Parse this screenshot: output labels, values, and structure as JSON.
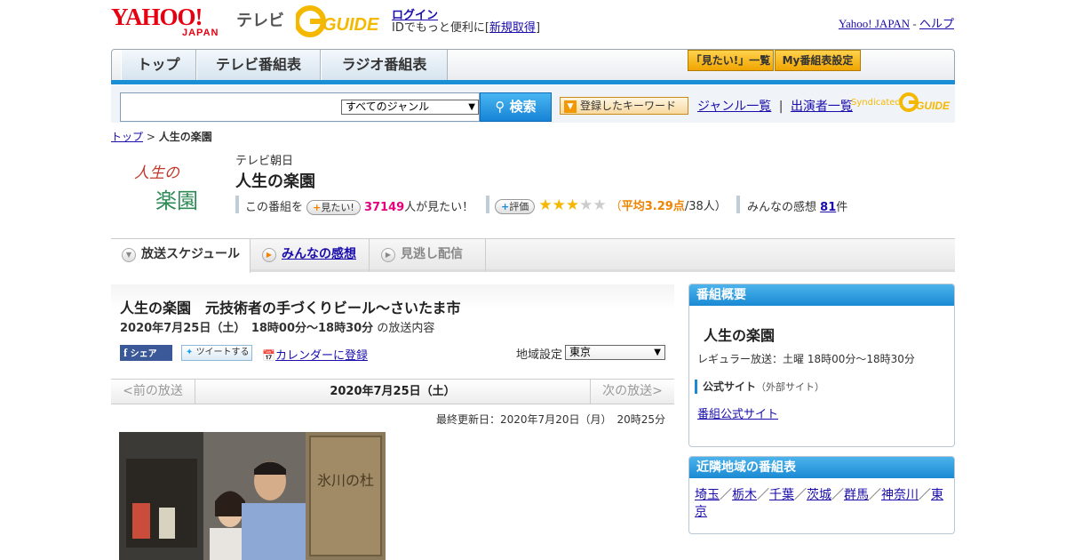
{
  "header": {
    "logo_yahoo": "YAHOO!",
    "logo_japan": "JAPAN",
    "tv": "テレビ",
    "gguide": "GUIDE",
    "login": "ログイン",
    "login_line_pre": "IDでもっと便利に[",
    "signup": "新規取得",
    "login_line_post": "]",
    "yahoo_japan": "Yahoo! JAPAN",
    "sep": " - ",
    "help": "ヘルプ"
  },
  "nav": {
    "tabs": [
      "トップ",
      "テレビ番組表",
      "ラジオ番組表"
    ],
    "mitai_list": "「見たい!」一覧",
    "my_schedule": "My番組表設定"
  },
  "search": {
    "placeholder": "",
    "genre": "すべてのジャンル",
    "button": "検索",
    "keywords": "登録したキーワード",
    "genre_list": "ジャンル一覧",
    "divider": "|",
    "performers": "出演者一覧",
    "syndicated": "Syndicated"
  },
  "breadcrumb": {
    "top": "トップ",
    "sep": " > ",
    "current": "人生の楽園"
  },
  "program": {
    "logo_text_1": "人生の",
    "logo_text_2": "楽園",
    "channel": "テレビ朝日",
    "title": "人生の楽園",
    "this_program": "この番組を",
    "mitai_pill": "見たい!",
    "mitai_count": "37149",
    "mitai_suffix": "人が見たい！",
    "rating_pill": "評価",
    "stars_filled": "★★★",
    "stars_empty": "★★",
    "rating_pre": "（",
    "rating_avg": "平均3.29点",
    "rating_post": "/38人）",
    "reviews_pre": "みんなの感想",
    "reviews_count": "81",
    "reviews_suffix": "件"
  },
  "tabs": {
    "schedule": "放送スケジュール",
    "reviews": "みんなの感想",
    "catchup": "見逃し配信"
  },
  "episode": {
    "title": "人生の楽園　元技術者の手づくりビール～さいたま市",
    "date_strong": "2020年7月25日（土）　18時00分～18時30分",
    "date_suffix": "の放送内容",
    "share": "シェア",
    "tweet": "ツイートする",
    "calendar": "カレンダーに登録",
    "region_label": "地域設定",
    "region_value": "東京",
    "prev": "<前の放送",
    "current_date": "2020年7月25日（土）",
    "next": "次の放送>",
    "updated": "最終更新日：2020年7月20日（月）　20時25分",
    "sign_text": "氷川の杜"
  },
  "sidebar": {
    "overview_head": "番組概要",
    "title": "人生の楽園",
    "regular": "レギュラー放送：土曜 18時00分～18時30分",
    "official": "公式サイト",
    "external": "（外部サイト）",
    "official_link": "番組公式サイト",
    "nearby_head": "近隣地域の番組表",
    "regions": [
      "埼玉",
      "栃木",
      "千葉",
      "茨城",
      "群馬",
      "神奈川",
      "東京"
    ],
    "region_sep": "／"
  }
}
